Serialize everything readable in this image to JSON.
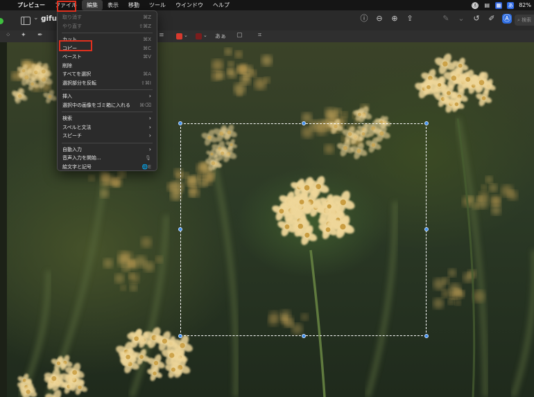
{
  "menubar": {
    "app": "プレビュー",
    "items": [
      "ファイル",
      "編集",
      "表示",
      "移動",
      "ツール",
      "ウインドウ",
      "ヘルプ"
    ],
    "active_index": 1,
    "battery": "82%"
  },
  "window": {
    "title": "gifu0",
    "search_placeholder": "検索"
  },
  "edit_menu": {
    "groups": [
      [
        {
          "label": "取り消す",
          "shortcut": "⌘Z",
          "disabled": true
        },
        {
          "label": "やり直す",
          "shortcut": "⇧⌘Z",
          "disabled": true
        }
      ],
      [
        {
          "label": "カット",
          "shortcut": "⌘X",
          "disabled": false
        },
        {
          "label": "コピー",
          "shortcut": "⌘C",
          "disabled": false
        },
        {
          "label": "ペースト",
          "shortcut": "⌘V",
          "disabled": false
        },
        {
          "label": "削除",
          "shortcut": "",
          "disabled": false
        },
        {
          "label": "すべてを選択",
          "shortcut": "⌘A",
          "disabled": false
        },
        {
          "label": "選択部分を反転",
          "shortcut": "⇧⌘I",
          "disabled": false
        }
      ],
      [
        {
          "label": "挿入",
          "shortcut": "›",
          "disabled": false
        },
        {
          "label": "選択中の画像をゴミ箱に入れる",
          "shortcut": "⌘⌫",
          "disabled": false
        }
      ],
      [
        {
          "label": "検索",
          "shortcut": "›",
          "disabled": false
        },
        {
          "label": "スペルと文法",
          "shortcut": "›",
          "disabled": false
        },
        {
          "label": "スピーチ",
          "shortcut": "›",
          "disabled": false
        }
      ],
      [
        {
          "label": "自動入力",
          "shortcut": "›",
          "disabled": false
        },
        {
          "label": "音声入力を開始...",
          "shortcut": "🎙",
          "disabled": false
        },
        {
          "label": "絵文字と記号",
          "shortcut": "🌐E",
          "disabled": false
        }
      ]
    ]
  },
  "markup": {
    "text_style": "あぁ",
    "border_color": "#d83a2e",
    "fill_color": "#7a1d1d"
  },
  "highlight": {
    "menu_item": "コピー",
    "menubar_item": "編集"
  }
}
